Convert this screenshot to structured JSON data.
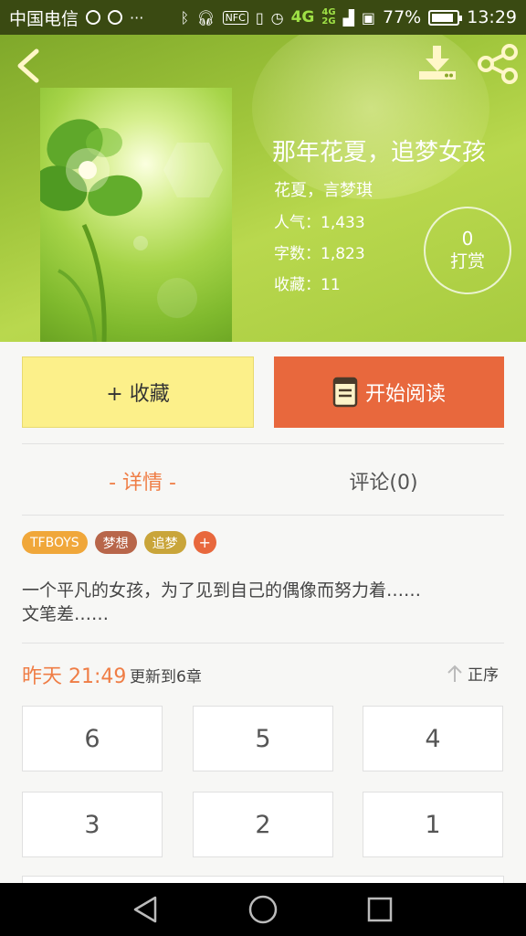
{
  "status_bar": {
    "carrier": "中国电信",
    "network": "4G",
    "network2_top": "4G",
    "network2_bottom": "2G",
    "battery_percent": "77%",
    "battery_level": 0.77,
    "time": "13:29"
  },
  "book": {
    "title": "那年花夏，追梦女孩",
    "author": "花夏，言梦琪",
    "popularity": "人气：1,433",
    "words": "字数：1,823",
    "favorites": "收藏：11",
    "tip_count": "0",
    "tip_label": "打赏"
  },
  "actions": {
    "favorite_label": "+ 收藏",
    "read_label": "开始阅读"
  },
  "tabs": [
    {
      "label": "- 详情 -",
      "active": true
    },
    {
      "label": "评论(0)",
      "active": false
    }
  ],
  "tags": [
    {
      "label": "TFBOYS",
      "color": "#f0a73a"
    },
    {
      "label": "梦想",
      "color": "#b8664a"
    },
    {
      "label": "追梦",
      "color": "#c9a53a"
    }
  ],
  "tag_add_label": "+",
  "description": {
    "line1": "一个平凡的女孩，为了见到自己的偶像而努力着……",
    "line2": "文笔差……"
  },
  "update": {
    "date": "昨天 21:49",
    "text": "更新到6章",
    "sort_label": "正序"
  },
  "chapters": [
    "6",
    "5",
    "4",
    "3",
    "2",
    "1"
  ],
  "colors": {
    "accent_orange": "#e8683d",
    "favorite_yellow": "#fcf08a",
    "header_green": "#9fc53b"
  },
  "icons": {
    "back": "back-arrow-icon",
    "download": "download-icon",
    "share": "share-icon",
    "book": "book-icon",
    "sort": "arrow-up-icon"
  }
}
